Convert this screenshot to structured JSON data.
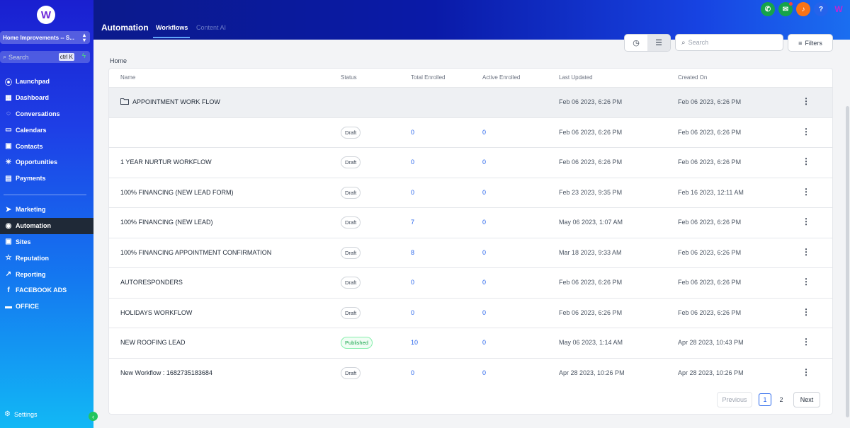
{
  "sidebar": {
    "logo": "W",
    "account": "Home Improvements -- S...",
    "search_placeholder": "Search",
    "search_shortcut": "ctrl K",
    "items_top": [
      {
        "label": "Launchpad",
        "icon": "launchpad-icon",
        "glyph": "⦿"
      },
      {
        "label": "Dashboard",
        "icon": "dashboard-icon",
        "glyph": "▦"
      },
      {
        "label": "Conversations",
        "icon": "chat-icon",
        "glyph": "◌"
      },
      {
        "label": "Calendars",
        "icon": "calendar-icon",
        "glyph": "▭"
      },
      {
        "label": "Contacts",
        "icon": "contacts-icon",
        "glyph": "▣"
      },
      {
        "label": "Opportunities",
        "icon": "opportunities-icon",
        "glyph": "✳"
      },
      {
        "label": "Payments",
        "icon": "payments-icon",
        "glyph": "▤"
      }
    ],
    "items_bottom": [
      {
        "label": "Marketing",
        "icon": "send-icon",
        "glyph": "➤"
      },
      {
        "label": "Automation",
        "icon": "automation-icon",
        "glyph": "◉",
        "active": true
      },
      {
        "label": "Sites",
        "icon": "sites-icon",
        "glyph": "▣"
      },
      {
        "label": "Reputation",
        "icon": "star-icon",
        "glyph": "☆"
      },
      {
        "label": "Reporting",
        "icon": "trend-icon",
        "glyph": "↗"
      },
      {
        "label": "FACEBOOK ADS",
        "icon": "facebook-icon",
        "glyph": "f"
      },
      {
        "label": "OFFICE",
        "icon": "briefcase-icon",
        "glyph": "▬"
      }
    ],
    "settings_label": "Settings"
  },
  "topbar": {
    "title": "Automation",
    "tabs": [
      "Workflows",
      "Content AI"
    ],
    "icons": [
      {
        "name": "phone-icon",
        "glyph": "✆",
        "color": "#16a34a"
      },
      {
        "name": "megaphone-icon",
        "glyph": "✉",
        "color": "#16a34a"
      },
      {
        "name": "bell-icon",
        "glyph": "♪",
        "color": "#f97316"
      },
      {
        "name": "help-icon",
        "glyph": "?",
        "color": "#2563eb"
      },
      {
        "name": "brand-icon",
        "glyph": "W",
        "color": "transparent"
      }
    ]
  },
  "toolbar": {
    "search_placeholder": "Search",
    "filters_label": "Filters"
  },
  "breadcrumb": "Home",
  "table": {
    "columns": [
      "Name",
      "Status",
      "Total Enrolled",
      "Active Enrolled",
      "Last Updated",
      "Created On"
    ],
    "rows": [
      {
        "name": "APPOINTMENT WORK FLOW",
        "folder": true,
        "status": "",
        "total": "",
        "active": "",
        "updated": "Feb 06 2023, 6:26 PM",
        "created": "Feb 06 2023, 6:26 PM"
      },
      {
        "name": "",
        "status": "Draft",
        "total": "0",
        "active": "0",
        "updated": "Feb 06 2023, 6:26 PM",
        "created": "Feb 06 2023, 6:26 PM"
      },
      {
        "name": "1 YEAR NURTUR WORKFLOW",
        "status": "Draft",
        "total": "0",
        "active": "0",
        "updated": "Feb 06 2023, 6:26 PM",
        "created": "Feb 06 2023, 6:26 PM"
      },
      {
        "name": "100% FINANCING (NEW LEAD FORM)",
        "status": "Draft",
        "total": "0",
        "active": "0",
        "updated": "Feb 23 2023, 9:35 PM",
        "created": "Feb 16 2023, 12:11 AM"
      },
      {
        "name": "100% FINANCING (NEW LEAD)",
        "status": "Draft",
        "total": "7",
        "active": "0",
        "updated": "May 06 2023, 1:07 AM",
        "created": "Feb 06 2023, 6:26 PM"
      },
      {
        "name": "100% FINANCING APPOINTMENT CONFIRMATION",
        "status": "Draft",
        "total": "8",
        "active": "0",
        "updated": "Mar 18 2023, 9:33 AM",
        "created": "Feb 06 2023, 6:26 PM"
      },
      {
        "name": "AUTORESPONDERS",
        "status": "Draft",
        "total": "0",
        "active": "0",
        "updated": "Feb 06 2023, 6:26 PM",
        "created": "Feb 06 2023, 6:26 PM"
      },
      {
        "name": "HOLIDAYS WORKFLOW",
        "status": "Draft",
        "total": "0",
        "active": "0",
        "updated": "Feb 06 2023, 6:26 PM",
        "created": "Feb 06 2023, 6:26 PM"
      },
      {
        "name": "NEW ROOFING LEAD",
        "status": "Published",
        "total": "10",
        "active": "0",
        "updated": "May 06 2023, 1:14 AM",
        "created": "Apr 28 2023, 10:43 PM"
      },
      {
        "name": "New Workflow : 1682735183684",
        "status": "Draft",
        "total": "0",
        "active": "0",
        "updated": "Apr 28 2023, 10:26 PM",
        "created": "Apr 28 2023, 10:26 PM"
      }
    ]
  },
  "pagination": {
    "previous": "Previous",
    "pages": [
      "1",
      "2"
    ],
    "current": "1",
    "next": "Next"
  }
}
